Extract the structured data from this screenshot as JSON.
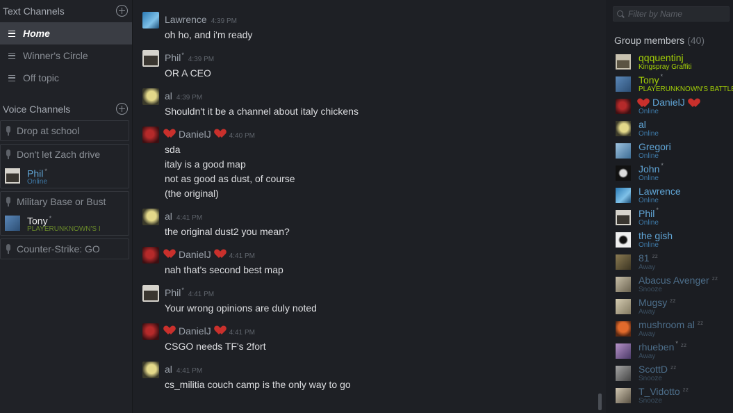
{
  "left": {
    "text_channels_label": "Text Channels",
    "text_channels": [
      {
        "label": "Home",
        "active": true
      },
      {
        "label": "Winner's Circle",
        "active": false
      },
      {
        "label": "Off topic",
        "active": false
      }
    ],
    "voice_channels_label": "Voice Channels",
    "voice_channels": [
      {
        "label": "Drop at school",
        "users": []
      },
      {
        "label": "Don't let Zach drive",
        "users": [
          {
            "name": "Phil",
            "star": "*",
            "status": "Online"
          }
        ]
      },
      {
        "label": "Military Base or Bust",
        "users": [
          {
            "name": "Tony",
            "star": "*",
            "status": "PLAYERUNKNOWN'S I"
          }
        ]
      },
      {
        "label": "Counter-Strike: GO",
        "users": []
      }
    ]
  },
  "chat": {
    "messages": [
      {
        "name": "Lawrence",
        "star": "",
        "time": "4:39 PM",
        "hearts": false,
        "lines": [
          "oh ho, and i'm ready"
        ]
      },
      {
        "name": "Phil",
        "star": "*",
        "time": "4:39 PM",
        "hearts": false,
        "lines": [
          "OR A CEO"
        ]
      },
      {
        "name": "al",
        "star": "",
        "time": "4:39 PM",
        "hearts": false,
        "lines": [
          "Shouldn't it be a channel about italy chickens"
        ]
      },
      {
        "name": "DanielJ",
        "star": "",
        "time": "4:40 PM",
        "hearts": true,
        "lines": [
          "sda",
          "italy is a good map",
          "not as good as dust, of course",
          "(the original)"
        ]
      },
      {
        "name": "al",
        "star": "",
        "time": "4:41 PM",
        "hearts": false,
        "lines": [
          "the original dust2 you mean?"
        ]
      },
      {
        "name": "DanielJ",
        "star": "",
        "time": "4:41 PM",
        "hearts": true,
        "lines": [
          "nah that's second best map"
        ]
      },
      {
        "name": "Phil",
        "star": "*",
        "time": "4:41 PM",
        "hearts": false,
        "lines": [
          "Your wrong opinions are duly noted"
        ]
      },
      {
        "name": "DanielJ",
        "star": "",
        "time": "4:41 PM",
        "hearts": true,
        "lines": [
          "CSGO needs TF's 2fort"
        ]
      },
      {
        "name": "al",
        "star": "",
        "time": "4:41 PM",
        "hearts": false,
        "lines": [
          "cs_militia couch camp is the only way to go"
        ]
      }
    ]
  },
  "right": {
    "search_placeholder": "Filter by Name",
    "group_label": "Group members",
    "group_count": "(40)",
    "members": [
      {
        "name": "qqquentinj",
        "star": "",
        "status": "Kingspray Graffiti",
        "state": "game",
        "hearts": false,
        "zz": false
      },
      {
        "name": "Tony",
        "star": "*",
        "status": "PLAYERUNKNOWN'S BATTLE",
        "state": "game",
        "hearts": false,
        "zz": false
      },
      {
        "name": "DanielJ",
        "star": "",
        "status": "Online",
        "state": "online",
        "hearts": true,
        "zz": false
      },
      {
        "name": "al",
        "star": "",
        "status": "Online",
        "state": "online",
        "hearts": false,
        "zz": false
      },
      {
        "name": "Gregori",
        "star": "",
        "status": "Online",
        "state": "online",
        "hearts": false,
        "zz": false
      },
      {
        "name": "John",
        "star": "*",
        "status": "Online",
        "state": "online",
        "hearts": false,
        "zz": false
      },
      {
        "name": "Lawrence",
        "star": "",
        "status": "Online",
        "state": "online",
        "hearts": false,
        "zz": false
      },
      {
        "name": "Phil",
        "star": "*",
        "status": "Online",
        "state": "online",
        "hearts": false,
        "zz": false
      },
      {
        "name": "the gish",
        "star": "",
        "status": "Online",
        "state": "online",
        "hearts": false,
        "zz": false
      },
      {
        "name": "81",
        "star": "",
        "status": "Away",
        "state": "away",
        "hearts": false,
        "zz": true
      },
      {
        "name": "Abacus Avenger",
        "star": "",
        "status": "Snooze",
        "state": "away",
        "hearts": false,
        "zz": true
      },
      {
        "name": "Mugsy",
        "star": "",
        "status": "Away",
        "state": "away",
        "hearts": false,
        "zz": true
      },
      {
        "name": "mushroom al",
        "star": "",
        "status": "Away",
        "state": "away",
        "hearts": false,
        "zz": true
      },
      {
        "name": "rhueben",
        "star": "*",
        "status": "Away",
        "state": "away",
        "hearts": false,
        "zz": true
      },
      {
        "name": "ScottD",
        "star": "",
        "status": "Snooze",
        "state": "away",
        "hearts": false,
        "zz": true
      },
      {
        "name": "T_Vidotto",
        "star": "",
        "status": "Snooze",
        "state": "away",
        "hearts": false,
        "zz": true
      }
    ]
  },
  "colors": {
    "game": "#a4d007",
    "online": "#60a5d6",
    "away": "#4d6e8a",
    "heart": "#c9302c"
  }
}
